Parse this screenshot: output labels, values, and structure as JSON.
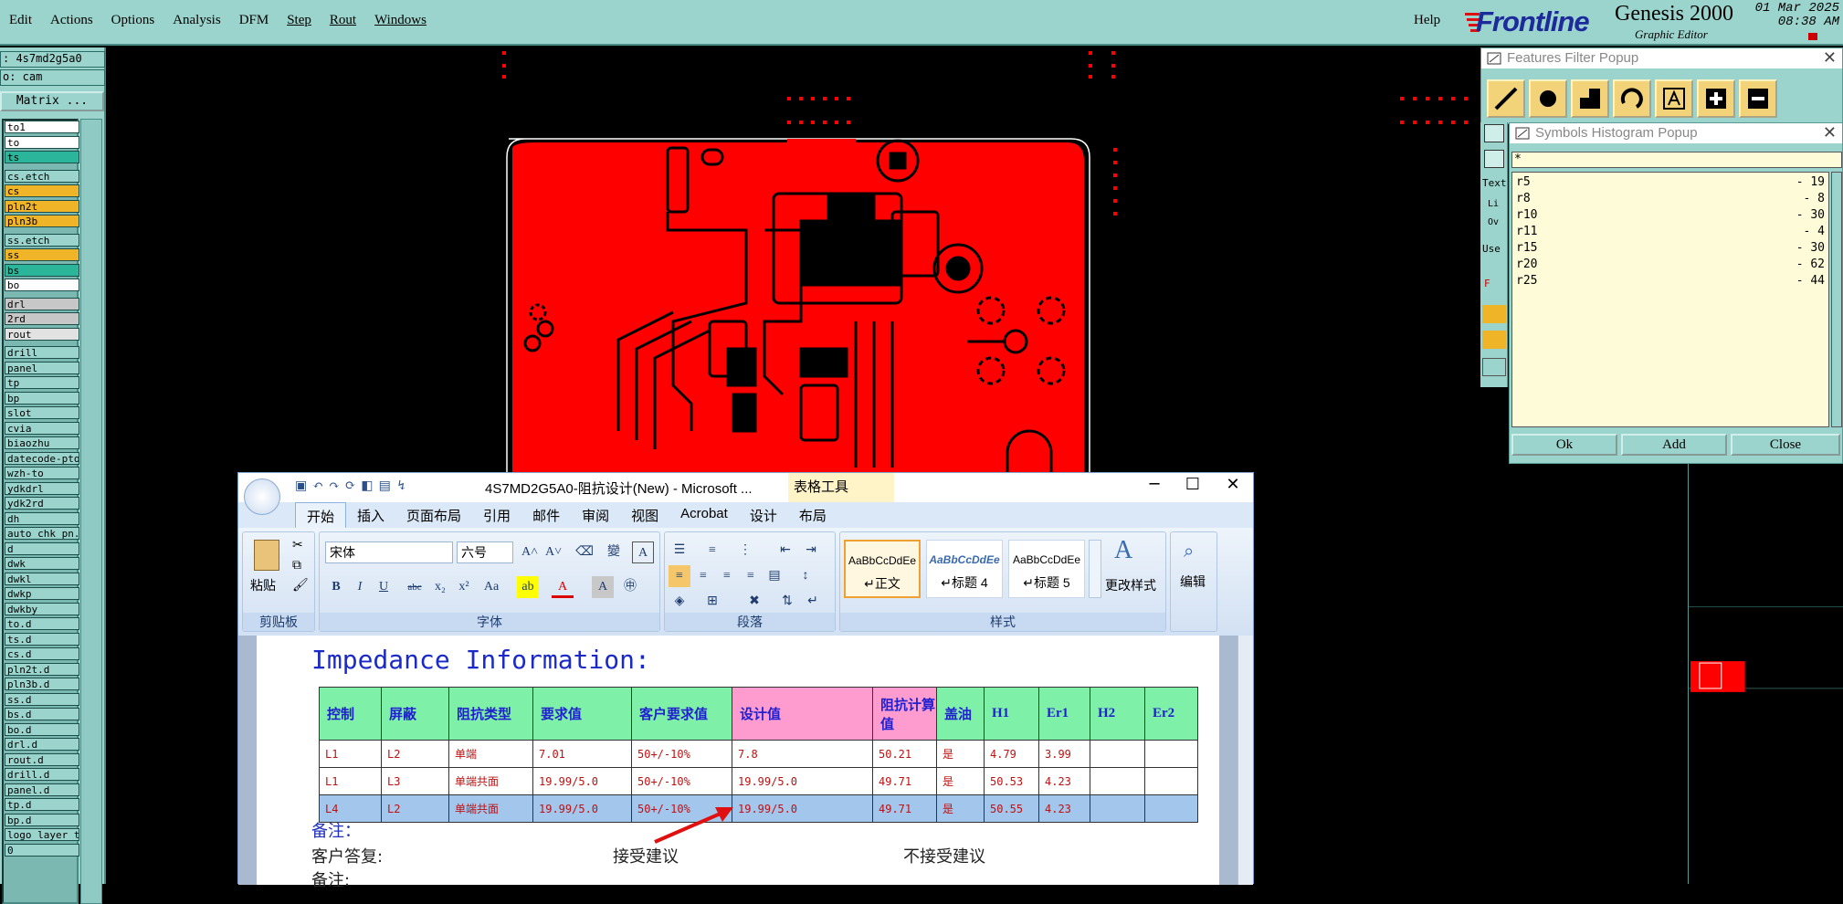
{
  "menubar": {
    "items": [
      "Edit",
      "Actions",
      "Options",
      "Analysis",
      "DFM",
      "Step",
      "Rout",
      "Windows"
    ],
    "help": "Help"
  },
  "brand": {
    "logo": "Frontline",
    "app": "Genesis 2000",
    "subtitle": "Graphic Editor",
    "date": "01 Mar 2025",
    "time": "08:38 AM"
  },
  "left_panel": {
    "job": ": 4s7md2g5a0",
    "step": "o: cam",
    "matrix_button": "Matrix ...",
    "layers": [
      {
        "name": "to1",
        "color": "#ffffff"
      },
      {
        "name": "to",
        "color": "#ffffff"
      },
      {
        "name": "ts",
        "color": "#2bb59a"
      },
      {
        "name": "cs.etch",
        "color": "#9bd4cd"
      },
      {
        "name": "cs",
        "color": "#f0b429"
      },
      {
        "name": "pln2t",
        "color": "#f0b429"
      },
      {
        "name": "pln3b",
        "color": "#f0b429"
      },
      {
        "name": "ss.etch",
        "color": "#9bd4cd"
      },
      {
        "name": "ss",
        "color": "#f0b429"
      },
      {
        "name": "bs",
        "color": "#2bb59a"
      },
      {
        "name": "bo",
        "color": "#ffffff"
      },
      {
        "name": "drl",
        "color": "#c7c7c7"
      },
      {
        "name": "2rd",
        "color": "#c7c7c7"
      },
      {
        "name": "rout",
        "color": "#e2e2e2"
      },
      {
        "name": "drill",
        "color": "#9bd4cd"
      },
      {
        "name": "panel",
        "color": "#9bd4cd"
      },
      {
        "name": "tp",
        "color": "#9bd4cd"
      },
      {
        "name": "bp",
        "color": "#9bd4cd"
      },
      {
        "name": "slot",
        "color": "#9bd4cd"
      },
      {
        "name": "cvia",
        "color": "#9bd4cd"
      },
      {
        "name": "biaozhu",
        "color": "#9bd4cd"
      },
      {
        "name": "datecode-pto",
        "color": "#9bd4cd"
      },
      {
        "name": "wzh-to",
        "color": "#9bd4cd"
      },
      {
        "name": "ydkdrl",
        "color": "#9bd4cd"
      },
      {
        "name": "ydk2rd",
        "color": "#9bd4cd"
      },
      {
        "name": "dh",
        "color": "#9bd4cd"
      },
      {
        "name": "auto_chk_pn.",
        "color": "#9bd4cd"
      },
      {
        "name": "d",
        "color": "#9bd4cd"
      },
      {
        "name": "dwk",
        "color": "#9bd4cd"
      },
      {
        "name": "dwkl",
        "color": "#9bd4cd"
      },
      {
        "name": "dwkp",
        "color": "#9bd4cd"
      },
      {
        "name": "dwkby",
        "color": "#9bd4cd"
      },
      {
        "name": "to.d",
        "color": "#9bd4cd"
      },
      {
        "name": "ts.d",
        "color": "#9bd4cd"
      },
      {
        "name": "cs.d",
        "color": "#9bd4cd"
      },
      {
        "name": "pln2t.d",
        "color": "#9bd4cd"
      },
      {
        "name": "pln3b.d",
        "color": "#9bd4cd"
      },
      {
        "name": "ss.d",
        "color": "#9bd4cd"
      },
      {
        "name": "bs.d",
        "color": "#9bd4cd"
      },
      {
        "name": "bo.d",
        "color": "#9bd4cd"
      },
      {
        "name": "drl.d",
        "color": "#9bd4cd"
      },
      {
        "name": "rout.d",
        "color": "#9bd4cd"
      },
      {
        "name": "drill.d",
        "color": "#9bd4cd"
      },
      {
        "name": "panel.d",
        "color": "#9bd4cd"
      },
      {
        "name": "tp.d",
        "color": "#9bd4cd"
      },
      {
        "name": "bp.d",
        "color": "#9bd4cd"
      },
      {
        "name": "logo_layer_t",
        "color": "#9bd4cd"
      },
      {
        "name": "0",
        "color": "#9bd4cd"
      }
    ]
  },
  "features_popup": {
    "title": "Features Filter Popup",
    "side_labels": [
      "Text",
      "Li",
      "Ov",
      "Use",
      "F"
    ]
  },
  "histogram_popup": {
    "title": "Symbols Histogram Popup",
    "filter": "*",
    "rows": [
      {
        "sym": "r5",
        "count": "- 19"
      },
      {
        "sym": "r8",
        "count": "- 8"
      },
      {
        "sym": "r10",
        "count": "- 30"
      },
      {
        "sym": "r11",
        "count": "- 4"
      },
      {
        "sym": "r15",
        "count": "- 30"
      },
      {
        "sym": "r20",
        "count": "- 62"
      },
      {
        "sym": "r25",
        "count": "- 44"
      }
    ],
    "ok": "Ok",
    "add": "Add",
    "close": "Close"
  },
  "word": {
    "title": "4S7MD2G5A0-阻抗设计(New) - Microsoft ...",
    "context_tab": "表格工具",
    "tabs": [
      "开始",
      "插入",
      "页面布局",
      "引用",
      "邮件",
      "审阅",
      "视图",
      "Acrobat",
      "设计",
      "布局"
    ],
    "font_name": "宋体",
    "font_size": "六号",
    "groups": {
      "clipboard": "剪贴板",
      "font": "字体",
      "paragraph": "段落",
      "styles": "样式"
    },
    "paste": "粘贴",
    "styles": [
      {
        "sample": "AaBbCcDdEe",
        "name": "↵正文"
      },
      {
        "sample": "AaBbCcDdEe",
        "name": "↵标题 4"
      },
      {
        "sample": "AaBbCcDdEe",
        "name": "↵标题 5"
      }
    ],
    "change_styles": "更改样式",
    "edit": "编辑",
    "doc": {
      "heading": "Impedance Information:",
      "headers": [
        "控制",
        "屏蔽",
        "阻抗类型",
        "要求值",
        "客户要求值",
        "设计值",
        "阻抗计算值",
        "盖油",
        "H1",
        "Er1",
        "H2",
        "Er2"
      ],
      "rows": [
        [
          "L1",
          "L2",
          "单端",
          "7.01",
          "50+/-10%",
          "7.8",
          "50.21",
          "是",
          "4.79",
          "3.99",
          "",
          ""
        ],
        [
          "L1",
          "L3",
          "单端共面",
          "19.99/5.0",
          "50+/-10%",
          "19.99/5.0",
          "49.71",
          "是",
          "50.53",
          "4.23",
          "",
          ""
        ],
        [
          "L4",
          "L2",
          "单端共面",
          "19.99/5.0",
          "50+/-10%",
          "19.99/5.0",
          "49.71",
          "是",
          "50.55",
          "4.23",
          "",
          ""
        ]
      ],
      "note_label": "备注：",
      "reply_label": "客户答复:",
      "accept": "接受建议",
      "reject": "不接受建议",
      "note2": "备注:"
    }
  }
}
